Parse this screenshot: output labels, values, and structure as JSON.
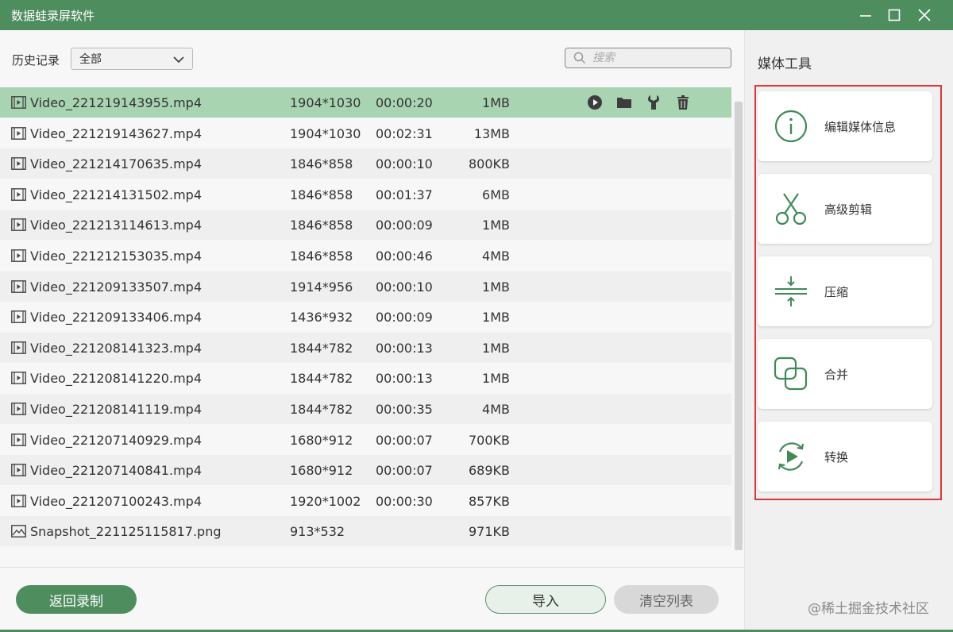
{
  "window": {
    "title": "数据蛙录屏软件"
  },
  "toolbar": {
    "history_label": "历史记录",
    "history_selected": "全部",
    "search_placeholder": "搜索"
  },
  "files": [
    {
      "name": "Video_221219143955.mp4",
      "resolution": "1904*1030",
      "duration": "00:00:20",
      "size": "1MB",
      "type": "video"
    },
    {
      "name": "Video_221219143627.mp4",
      "resolution": "1904*1030",
      "duration": "00:02:31",
      "size": "13MB",
      "type": "video"
    },
    {
      "name": "Video_221214170635.mp4",
      "resolution": "1846*858",
      "duration": "00:00:10",
      "size": "800KB",
      "type": "video"
    },
    {
      "name": "Video_221214131502.mp4",
      "resolution": "1846*858",
      "duration": "00:01:37",
      "size": "6MB",
      "type": "video"
    },
    {
      "name": "Video_221213114613.mp4",
      "resolution": "1846*858",
      "duration": "00:00:09",
      "size": "1MB",
      "type": "video"
    },
    {
      "name": "Video_221212153035.mp4",
      "resolution": "1846*858",
      "duration": "00:00:46",
      "size": "4MB",
      "type": "video"
    },
    {
      "name": "Video_221209133507.mp4",
      "resolution": "1914*956",
      "duration": "00:00:10",
      "size": "1MB",
      "type": "video"
    },
    {
      "name": "Video_221209133406.mp4",
      "resolution": "1436*932",
      "duration": "00:00:09",
      "size": "1MB",
      "type": "video"
    },
    {
      "name": "Video_221208141323.mp4",
      "resolution": "1844*782",
      "duration": "00:00:13",
      "size": "1MB",
      "type": "video"
    },
    {
      "name": "Video_221208141220.mp4",
      "resolution": "1844*782",
      "duration": "00:00:13",
      "size": "1MB",
      "type": "video"
    },
    {
      "name": "Video_221208141119.mp4",
      "resolution": "1844*782",
      "duration": "00:00:35",
      "size": "4MB",
      "type": "video"
    },
    {
      "name": "Video_221207140929.mp4",
      "resolution": "1680*912",
      "duration": "00:00:07",
      "size": "700KB",
      "type": "video"
    },
    {
      "name": "Video_221207140841.mp4",
      "resolution": "1680*912",
      "duration": "00:00:07",
      "size": "689KB",
      "type": "video"
    },
    {
      "name": "Video_221207100243.mp4",
      "resolution": "1920*1002",
      "duration": "00:00:30",
      "size": "857KB",
      "type": "video"
    },
    {
      "name": "Snapshot_221125115817.png",
      "resolution": "913*532",
      "duration": "",
      "size": "971KB",
      "type": "image"
    }
  ],
  "row_actions": [
    "play-icon",
    "folder-icon",
    "wrench-icon",
    "trash-icon"
  ],
  "buttons": {
    "back": "返回录制",
    "import": "导入",
    "clear": "清空列表"
  },
  "tools": {
    "title": "媒体工具",
    "items": [
      {
        "label": "编辑媒体信息",
        "icon": "info-icon"
      },
      {
        "label": "高级剪辑",
        "icon": "scissors-icon"
      },
      {
        "label": "压缩",
        "icon": "compress-icon"
      },
      {
        "label": "合并",
        "icon": "merge-icon"
      },
      {
        "label": "转换",
        "icon": "convert-icon"
      }
    ]
  },
  "watermark": "@稀土掘金技术社区",
  "colors": {
    "brand": "#4e8d5e",
    "selected_row": "#a9d4b1",
    "highlight_frame": "#e03636"
  }
}
